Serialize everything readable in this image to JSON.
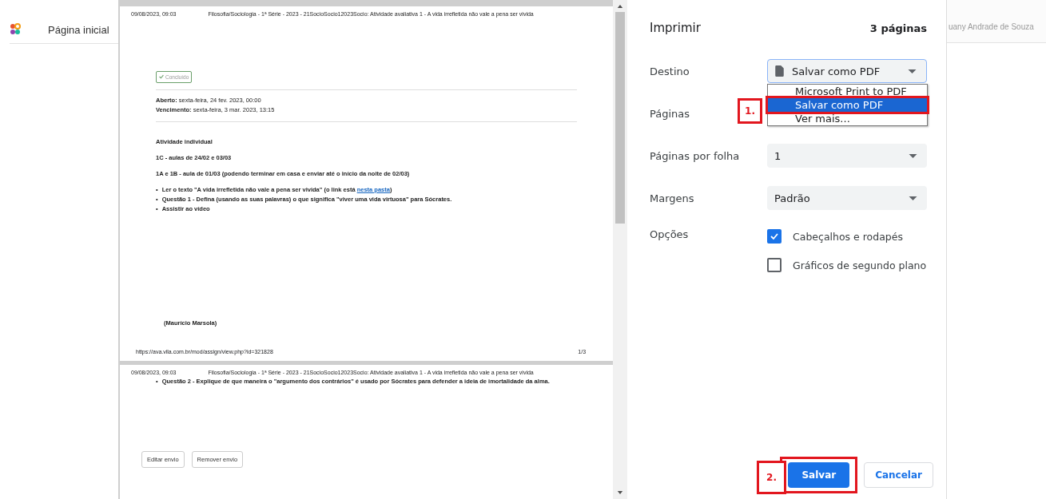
{
  "nav": {
    "link": "Página inicial"
  },
  "background_user": "uany Andrade de Souza",
  "preview": {
    "pages": [
      {
        "header_date": "09/08/2023, 09:03",
        "header_title": "Filosofia/Sociologia - 1ª Série - 2023 - 21SocioSocio12023Socio: Atividade avaliativa 1 - A vida irrefletida não vale a pena ser vivida",
        "badge": "Concluído",
        "dates": [
          "**Aberto:** sexta-feira, 24 fev. 2023, 00:00",
          "**Vencimento:** sexta-feira, 3 mar. 2023, 13:15"
        ],
        "headings": [
          "Atividade individual",
          "1C - aulas de 24/02 e 03/03",
          "1A e 1B - aula de 01/03 (podendo terminar em casa e enviar até o início da noite de 02/03)"
        ],
        "bullets": [
          {
            "marker": "•",
            "text": "Ler o texto \"A vida irrefletida não vale a pena ser vivida\" (o link está ",
            "link": "nesta pasta",
            "after": ")"
          },
          {
            "marker": "•",
            "text": "Questão 1 - Defina (usando as suas palavras) o que significa \"viver uma vida virtuosa\" para Sócrates."
          },
          {
            "marker": "•",
            "text": "Assistir ao vídeo"
          }
        ],
        "signature": "(Maurício Marsola)",
        "footer_url": "https://ava.vila.com.br/mod/assign/view.php?id=321828",
        "page_number": "1/3"
      },
      {
        "header_date": "09/08/2023, 09:03",
        "header_title": "Filosofia/Sociologia - 1ª Série - 2023 - 21SocioSocio12023Socio: Atividade avaliativa 1 - A vida irrefletida não vale a pena ser vivida",
        "bullets": [
          {
            "marker": "•",
            "text": "Questão 2 - Explique de que maneira o \"argumento dos contrários\" é usado por Sócrates para defender a ideia de imortalidade da alma."
          }
        ],
        "buttons": [
          "Editar envio",
          "Remover envio"
        ]
      }
    ]
  },
  "print_dialog": {
    "title": "Imprimir",
    "page_count": "3 páginas",
    "destination": {
      "label": "Destino",
      "value": "Salvar como PDF",
      "options": [
        {
          "label": "Microsoft Print to PDF",
          "selected": false,
          "highlighted": false
        },
        {
          "label": "Salvar como PDF",
          "selected": true,
          "highlighted": true
        },
        {
          "label": "Ver mais...",
          "selected": false,
          "highlighted": false
        }
      ]
    },
    "pages": {
      "label": "Páginas",
      "marker": "1."
    },
    "pages_per_sheet": {
      "label": "Páginas por folha",
      "value": "1"
    },
    "margins": {
      "label": "Margens",
      "value": "Padrão"
    },
    "options": {
      "label": "Opções",
      "items": [
        {
          "label": "Cabeçalhos e rodapés",
          "checked": true
        },
        {
          "label": "Gráficos de segundo plano",
          "checked": false
        }
      ]
    },
    "save": {
      "label": "Salvar",
      "highlighted": true,
      "marker": "2."
    },
    "cancel": {
      "label": "Cancelar"
    }
  }
}
